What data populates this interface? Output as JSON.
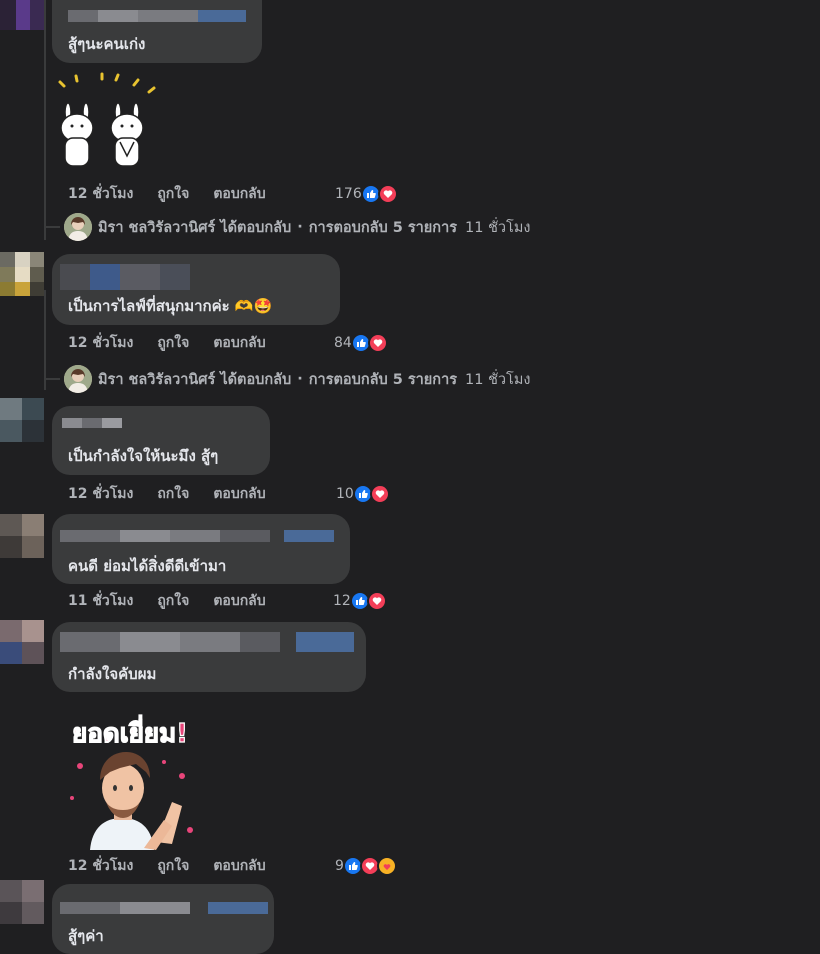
{
  "comments": [
    {
      "text": "สู้ๆนะคนเก่ง"
    },
    {
      "text": "",
      "sticker": "bunny-clapping-sticker",
      "time": "12 ชั่วโมง",
      "like_label": "ถูกใจ",
      "reply_label": "ตอบกลับ",
      "reaction_count": "176"
    },
    {
      "text": "เป็นการไลฟ์ที่สนุกมากค่ะ 🫶🤩",
      "time": "12 ชั่วโมง",
      "like_label": "ถูกใจ",
      "reply_label": "ตอบกลับ",
      "reaction_count": "84"
    },
    {
      "text": "เป็นกำลังใจให้นะมึง สู้ๆ",
      "time": "12 ชั่วโมง",
      "like_label": "ถกใจ",
      "reply_label": "ตอบกลับ",
      "reaction_count": "10"
    },
    {
      "text": "คนดี ย่อมได้สิ่งดีดีเข้ามา",
      "time": "11 ชั่วโมง",
      "like_label": "ถูกใจ",
      "reply_label": "ตอบกลับ",
      "reaction_count": "12"
    },
    {
      "text": "กำลังใจคับผม",
      "sticker": "man-clapping-sticker",
      "sticker_text": "ยอดเยี่ยม!",
      "time": "12 ชั่วโมง",
      "like_label": "ถูกใจ",
      "reply_label": "ตอบกลับ",
      "reaction_count": "9"
    },
    {
      "text": "สู้ๆค่า"
    }
  ],
  "replies": [
    {
      "name": "มิรา ชลวิรัลวานิศร์",
      "action": "ได้ตอบกลับ",
      "dot": "·",
      "summary": "การตอบกลับ 5 รายการ",
      "time": "11 ชั่วโมง"
    },
    {
      "name": "มิรา ชลวิรัลวานิศร์",
      "action": "ได้ตอบกลับ",
      "dot": "·",
      "summary": "การตอบกลับ 5 รายการ",
      "time": "11 ชั่วโมง"
    }
  ],
  "colors": {
    "background": "#1f1f21",
    "bubble": "#3a3b3c",
    "text": "#e4e6eb",
    "muted": "#b0b3b8",
    "like": "#1877f2",
    "love": "#f33e58",
    "care": "#f7b125"
  }
}
